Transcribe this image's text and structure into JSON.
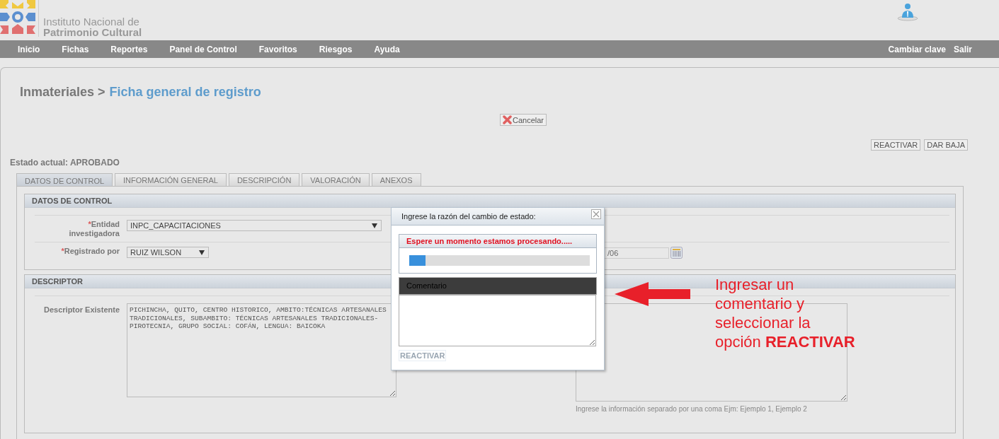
{
  "header": {
    "logo_lines": [
      "Instituto Nacional de",
      "Patrimonio Cultural"
    ]
  },
  "nav": {
    "left": [
      "Inicio",
      "Fichas",
      "Reportes",
      "Panel de Control",
      "Favoritos",
      "Riesgos",
      "Ayuda"
    ],
    "right": [
      "Cambiar clave",
      "Salir"
    ]
  },
  "breadcrumb": {
    "section": "Inmateriales >",
    "page": "Ficha general de registro"
  },
  "cancel_button": "Cancelar",
  "action_buttons": [
    "REACTIVAR",
    "DAR BAJA"
  ],
  "status": "Estado actual: APROBADO",
  "tabs": [
    {
      "label": "DATOS DE CONTROL",
      "selected": true
    },
    {
      "label": "INFORMACIÓN GENERAL",
      "selected": false
    },
    {
      "label": "DESCRIPCIÓN",
      "selected": false
    },
    {
      "label": "VALORACIÓN",
      "selected": false
    },
    {
      "label": "ANEXOS",
      "selected": false
    }
  ],
  "datos_de_control": {
    "title": "DATOS DE CONTROL",
    "fields": [
      {
        "required_mark": "*",
        "label": "Entidad investigadora",
        "value": "INPC_CAPACITACIONES",
        "kind": "wide"
      },
      {
        "required_mark": "*",
        "label": "Registrado por",
        "value": "RUIZ WILSON",
        "kind": "narrow"
      }
    ],
    "date_value": "/06"
  },
  "descriptor": {
    "title": "DESCRIPTOR",
    "label": "Descriptor Existente",
    "value": "PICHINCHA, QUITO, CENTRO HISTORICO, AMBITO:TÉCNICAS ARTESANALES TRADICIONALES, SUBAMBITO: TÉCNICAS ARTESANALES TRADICIONALES-PIROTECNIA, GRUPO SOCIAL: COFÁN, LENGUA: BAICOKA",
    "hint": "Ingrese la información separado por una coma Ejm: Ejemplo 1, Ejemplo 2"
  },
  "dialog": {
    "title": "Ingrese la razón del cambio de estado:",
    "message": "Espere un momento estamos procesando.....",
    "level": 0.09,
    "comment_label": "Comentario",
    "submit": {
      "label": "REACTIVAR",
      "disabled": true
    }
  },
  "annotation": {
    "text": "Ingresar un\ncomentario y\nseleccionar la\nopción **REACTIVAR**"
  }
}
